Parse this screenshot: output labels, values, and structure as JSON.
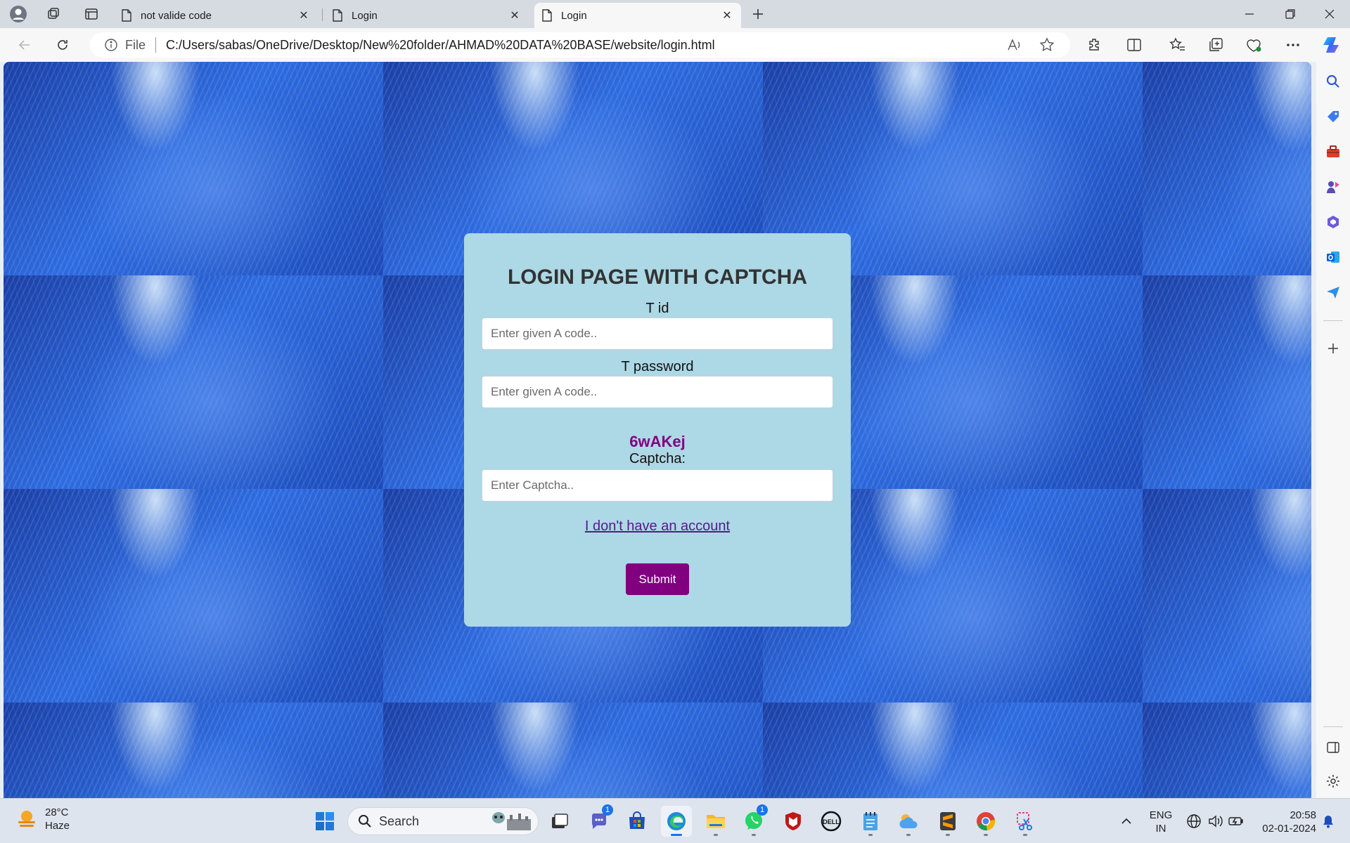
{
  "browser": {
    "tabs": [
      {
        "title": "not valide code"
      },
      {
        "title": "Login"
      },
      {
        "title": "Login"
      }
    ],
    "address": {
      "scheme_label": "File",
      "url": "C:/Users/sabas/OneDrive/Desktop/New%20folder/AHMAD%20DATA%20BASE/website/login.html"
    }
  },
  "page": {
    "title": "LOGIN PAGE WITH CAPTCHA",
    "tid_label": "T id",
    "tid_placeholder": "Enter given A code..",
    "password_label": "T password",
    "password_placeholder": "Enter given A code..",
    "captcha_code": "6wAKej",
    "captcha_label": "Captcha:",
    "captcha_placeholder": "Enter Captcha..",
    "signup_link": "I don't have an account",
    "submit_label": "Submit",
    "colors": {
      "panel": "#add8e6",
      "accent": "#800080",
      "link": "#551a8b"
    }
  },
  "taskbar": {
    "weather_temp": "28°C",
    "weather_desc": "Haze",
    "search_label": "Search",
    "chat_badge": "1",
    "whatsapp_badge": "1",
    "lang_line1": "ENG",
    "lang_line2": "IN",
    "time": "20:58",
    "date": "02-01-2024"
  }
}
